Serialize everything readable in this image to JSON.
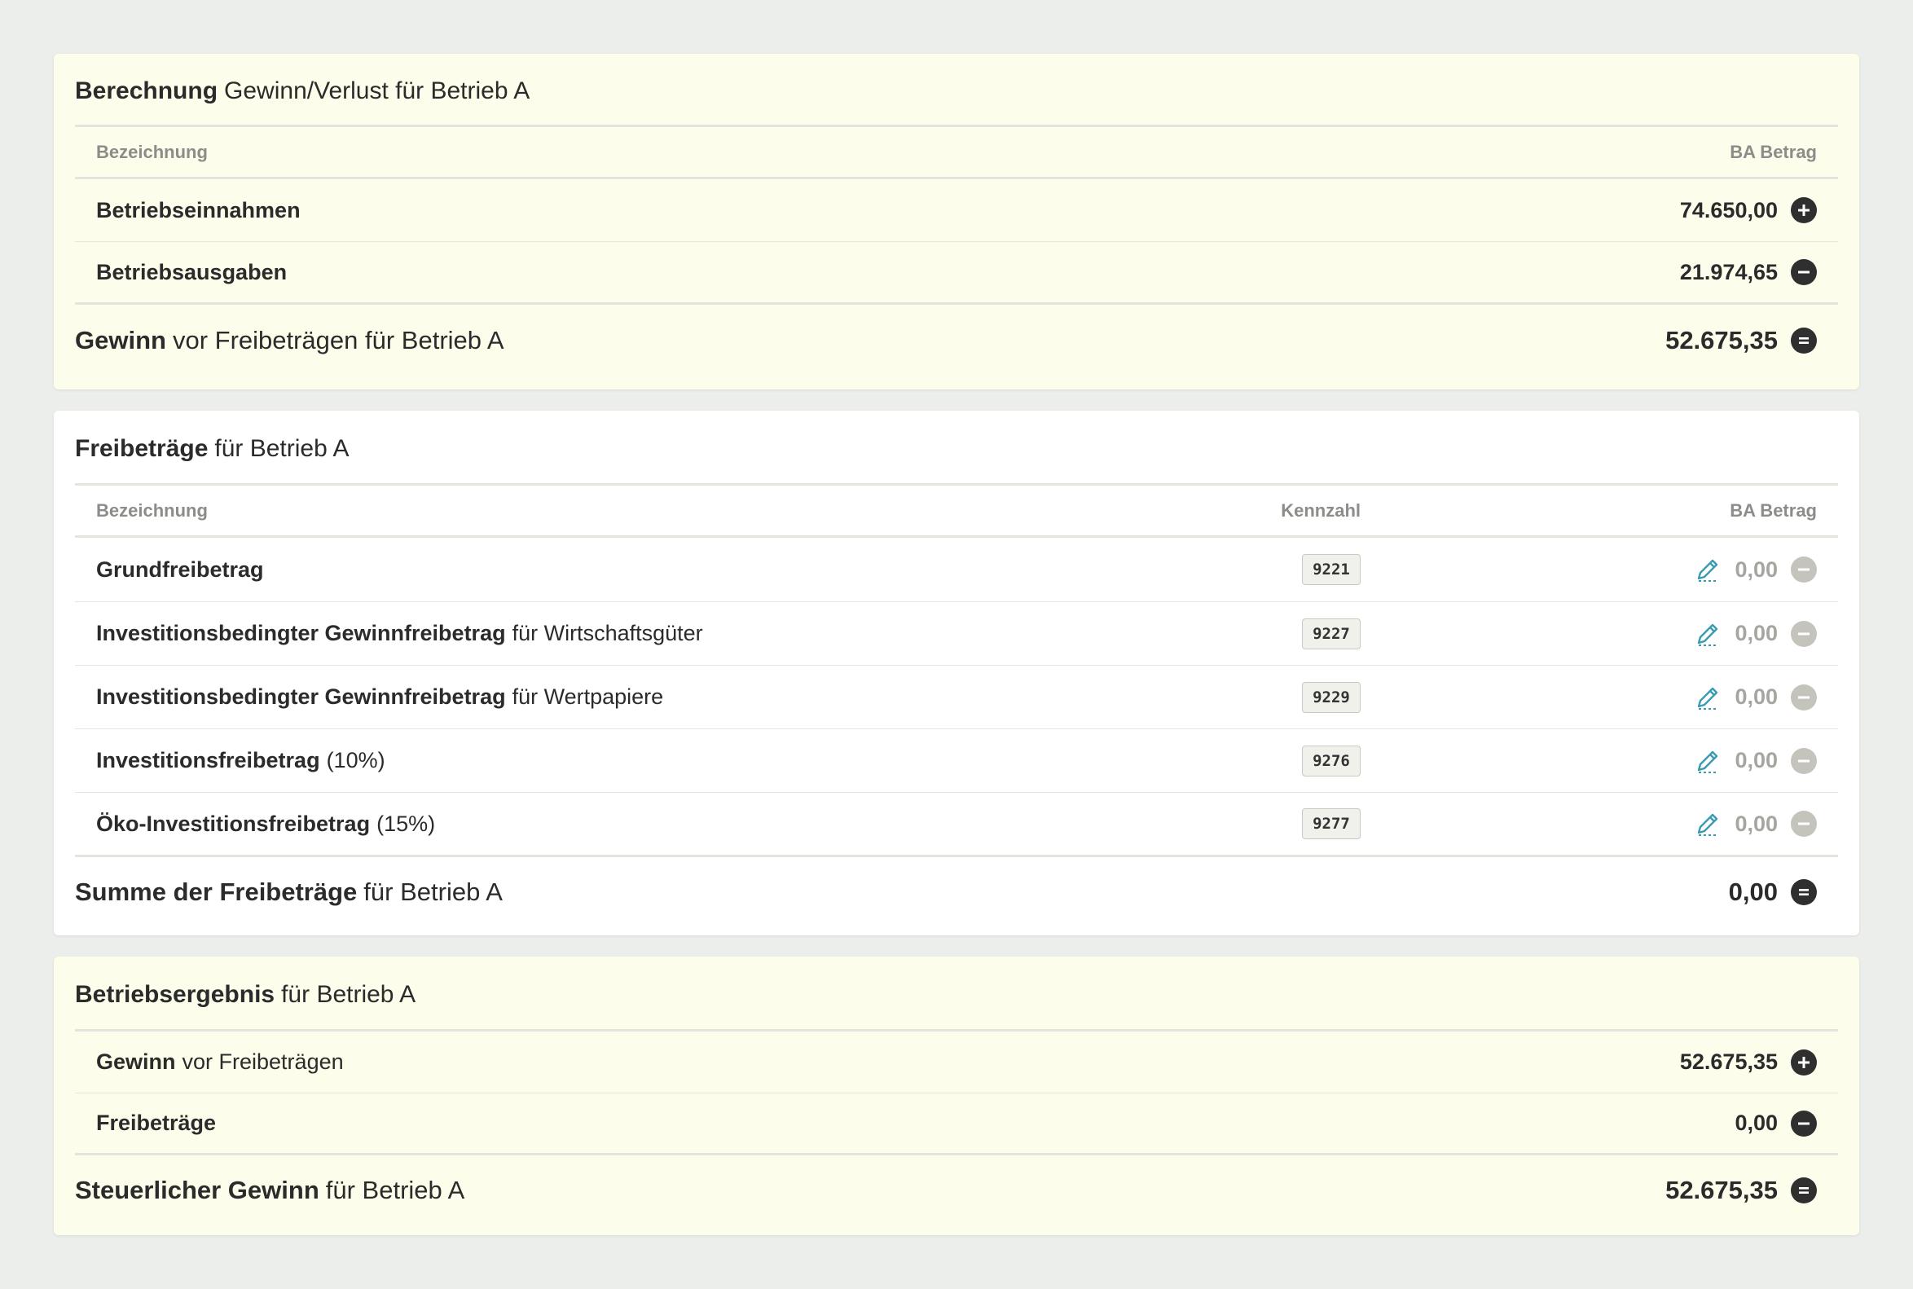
{
  "card1": {
    "title_bold": "Berechnung",
    "title_rest": "Gewinn/Verlust für Betrieb A",
    "col_name": "Bezeichnung",
    "col_amount": "BA Betrag",
    "rows": [
      {
        "label": "Betriebseinnahmen",
        "amount": "74.650,00",
        "icon": "plus-icon"
      },
      {
        "label": "Betriebsausgaben",
        "amount": "21.974,65",
        "icon": "minus-icon"
      }
    ],
    "sum_bold": "Gewinn",
    "sum_rest": "vor Freibeträgen für Betrieb A",
    "sum_amount": "52.675,35"
  },
  "card2": {
    "title_bold": "Freibeträge",
    "title_rest": "für Betrieb A",
    "col_name": "Bezeichnung",
    "col_kz": "Kennzahl",
    "col_amount": "BA Betrag",
    "rows": [
      {
        "label_bold": "Grundfreibetrag",
        "label_rest": "",
        "kz": "9221",
        "amount": "0,00"
      },
      {
        "label_bold": "Investitionsbedingter Gewinnfreibetrag",
        "label_rest": "für Wirtschaftsgüter",
        "kz": "9227",
        "amount": "0,00"
      },
      {
        "label_bold": "Investitionsbedingter Gewinnfreibetrag",
        "label_rest": "für Wertpapiere",
        "kz": "9229",
        "amount": "0,00"
      },
      {
        "label_bold": "Investitionsfreibetrag",
        "label_rest": "(10%)",
        "kz": "9276",
        "amount": "0,00"
      },
      {
        "label_bold": "Öko-Investitionsfreibetrag",
        "label_rest": "(15%)",
        "kz": "9277",
        "amount": "0,00"
      }
    ],
    "sum_bold": "Summe der Freibeträge",
    "sum_rest": "für Betrieb A",
    "sum_amount": "0,00"
  },
  "card3": {
    "title_bold": "Betriebsergebnis",
    "title_rest": "für Betrieb A",
    "rows": [
      {
        "label_bold": "Gewinn",
        "label_rest": "vor Freibeträgen",
        "amount": "52.675,35",
        "icon": "plus-icon"
      },
      {
        "label_bold": "Freibeträge",
        "label_rest": "",
        "amount": "0,00",
        "icon": "minus-icon"
      }
    ],
    "sum_bold": "Steuerlicher Gewinn",
    "sum_rest": "für Betrieb A",
    "sum_amount": "52.675,35"
  },
  "colors": {
    "background": "#eceeeb",
    "card_yellow": "#fdfdeb",
    "card_white": "#ffffff",
    "icon_dark": "#2f2f2f",
    "icon_muted": "#c4c4bc",
    "pencil": "#3a9bb0"
  }
}
